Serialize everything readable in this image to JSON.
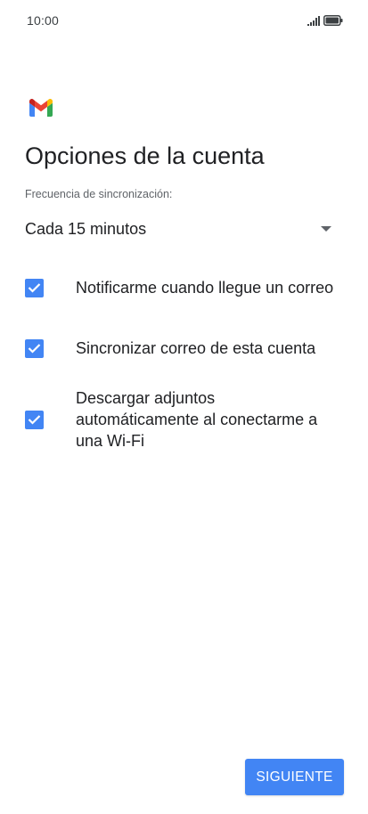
{
  "status_bar": {
    "time": "10:00",
    "signal_icon": "signal-icon",
    "battery_icon": "battery-icon"
  },
  "app": {
    "logo_icon": "gmail-logo-icon"
  },
  "page": {
    "title": "Opciones de la cuenta"
  },
  "sync": {
    "label": "Frecuencia de sincronización:",
    "selected_value": "Cada 15 minutos"
  },
  "options": [
    {
      "label": "Notificarme cuando llegue un correo",
      "checked": true
    },
    {
      "label": "Sincronizar correo de esta cuenta",
      "checked": true
    },
    {
      "label": "Descargar adjuntos automáticamente al conectarme a una Wi-Fi",
      "checked": true
    }
  ],
  "footer": {
    "next_label": "SIGUIENTE"
  },
  "colors": {
    "accent": "#4285f4",
    "text_primary": "#202124",
    "text_secondary": "#5f6368"
  }
}
